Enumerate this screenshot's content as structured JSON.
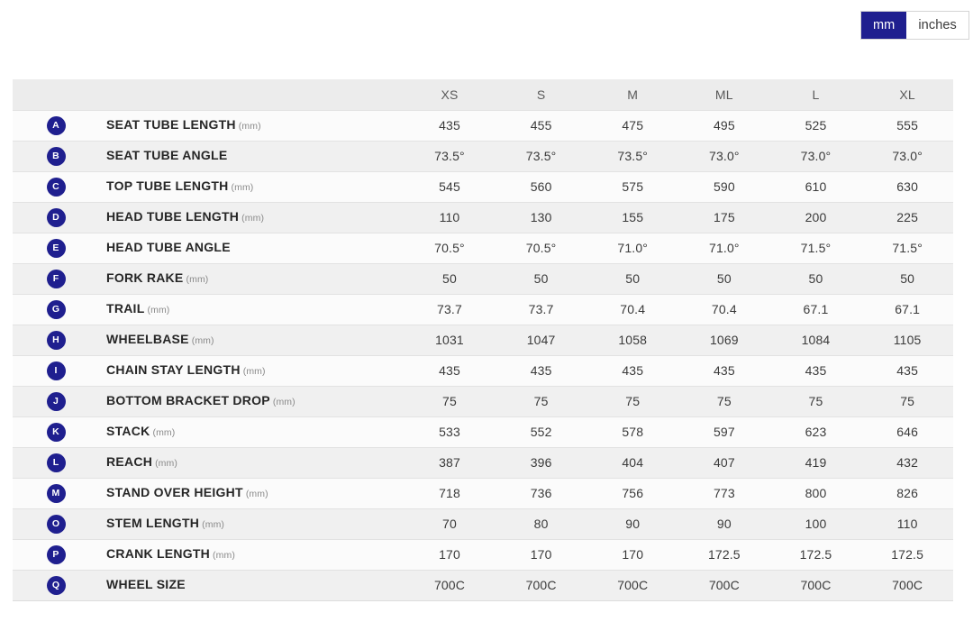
{
  "units_toggle": {
    "options": [
      {
        "label": "mm",
        "selected": true
      },
      {
        "label": "inches",
        "selected": false
      }
    ],
    "active_color": "#1f1f8f"
  },
  "table": {
    "corner_header": "",
    "size_headers": [
      "XS",
      "S",
      "M",
      "ML",
      "L",
      "XL"
    ],
    "rows": [
      {
        "badge": "A",
        "label": "SEAT TUBE LENGTH",
        "unit": "(mm)",
        "values": [
          "435",
          "455",
          "475",
          "495",
          "525",
          "555"
        ]
      },
      {
        "badge": "B",
        "label": "SEAT TUBE ANGLE",
        "unit": "",
        "values": [
          "73.5°",
          "73.5°",
          "73.5°",
          "73.0°",
          "73.0°",
          "73.0°"
        ]
      },
      {
        "badge": "C",
        "label": "TOP TUBE LENGTH",
        "unit": "(mm)",
        "values": [
          "545",
          "560",
          "575",
          "590",
          "610",
          "630"
        ]
      },
      {
        "badge": "D",
        "label": "HEAD TUBE LENGTH",
        "unit": "(mm)",
        "values": [
          "110",
          "130",
          "155",
          "175",
          "200",
          "225"
        ]
      },
      {
        "badge": "E",
        "label": "HEAD TUBE ANGLE",
        "unit": "",
        "values": [
          "70.5°",
          "70.5°",
          "71.0°",
          "71.0°",
          "71.5°",
          "71.5°"
        ]
      },
      {
        "badge": "F",
        "label": "FORK RAKE",
        "unit": "(mm)",
        "values": [
          "50",
          "50",
          "50",
          "50",
          "50",
          "50"
        ]
      },
      {
        "badge": "G",
        "label": "TRAIL",
        "unit": "(mm)",
        "values": [
          "73.7",
          "73.7",
          "70.4",
          "70.4",
          "67.1",
          "67.1"
        ]
      },
      {
        "badge": "H",
        "label": "WHEELBASE",
        "unit": "(mm)",
        "values": [
          "1031",
          "1047",
          "1058",
          "1069",
          "1084",
          "1105"
        ]
      },
      {
        "badge": "I",
        "label": "CHAIN STAY LENGTH",
        "unit": "(mm)",
        "values": [
          "435",
          "435",
          "435",
          "435",
          "435",
          "435"
        ]
      },
      {
        "badge": "J",
        "label": "BOTTOM BRACKET DROP",
        "unit": "(mm)",
        "values": [
          "75",
          "75",
          "75",
          "75",
          "75",
          "75"
        ]
      },
      {
        "badge": "K",
        "label": "STACK",
        "unit": "(mm)",
        "values": [
          "533",
          "552",
          "578",
          "597",
          "623",
          "646"
        ]
      },
      {
        "badge": "L",
        "label": "REACH",
        "unit": "(mm)",
        "values": [
          "387",
          "396",
          "404",
          "407",
          "419",
          "432"
        ]
      },
      {
        "badge": "M",
        "label": "STAND OVER HEIGHT",
        "unit": "(mm)",
        "values": [
          "718",
          "736",
          "756",
          "773",
          "800",
          "826"
        ]
      },
      {
        "badge": "O",
        "label": "STEM LENGTH",
        "unit": "(mm)",
        "values": [
          "70",
          "80",
          "90",
          "90",
          "100",
          "110"
        ]
      },
      {
        "badge": "P",
        "label": "CRANK LENGTH",
        "unit": "(mm)",
        "values": [
          "170",
          "170",
          "170",
          "172.5",
          "172.5",
          "172.5"
        ]
      },
      {
        "badge": "Q",
        "label": "WHEEL SIZE",
        "unit": "",
        "values": [
          "700C",
          "700C",
          "700C",
          "700C",
          "700C",
          "700C"
        ]
      }
    ]
  }
}
